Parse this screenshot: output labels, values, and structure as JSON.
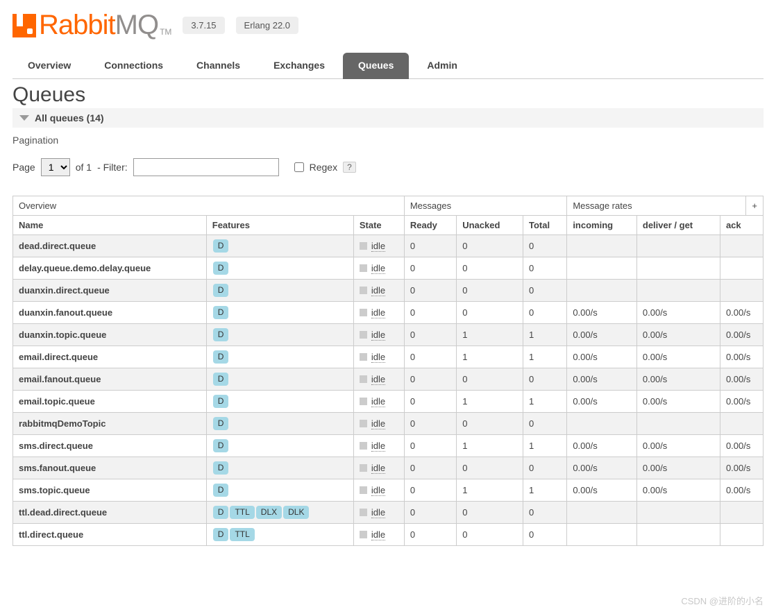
{
  "brand": {
    "text_left": "Rabbit",
    "text_right": "MQ",
    "tm": "TM"
  },
  "version_badges": [
    "3.7.15",
    "Erlang 22.0"
  ],
  "tabs": {
    "items": [
      "Overview",
      "Connections",
      "Channels",
      "Exchanges",
      "Queues",
      "Admin"
    ],
    "active_index": 4
  },
  "page_title": "Queues",
  "section_label": "All queues (14)",
  "pagination": {
    "title": "Pagination",
    "page_label": "Page",
    "page_value": "1",
    "of_text": "of 1",
    "filter_label": "- Filter:",
    "filter_value": "",
    "regex_label": "Regex",
    "help": "?"
  },
  "table": {
    "group_headers": [
      "Overview",
      "Messages",
      "Message rates",
      "+"
    ],
    "columns": [
      "Name",
      "Features",
      "State",
      "Ready",
      "Unacked",
      "Total",
      "incoming",
      "deliver / get",
      "ack"
    ],
    "rows": [
      {
        "name": "dead.direct.queue",
        "features": [
          "D"
        ],
        "state": "idle",
        "ready": "0",
        "unacked": "0",
        "total": "0",
        "incoming": "",
        "deliver": "",
        "ack": ""
      },
      {
        "name": "delay.queue.demo.delay.queue",
        "features": [
          "D"
        ],
        "state": "idle",
        "ready": "0",
        "unacked": "0",
        "total": "0",
        "incoming": "",
        "deliver": "",
        "ack": ""
      },
      {
        "name": "duanxin.direct.queue",
        "features": [
          "D"
        ],
        "state": "idle",
        "ready": "0",
        "unacked": "0",
        "total": "0",
        "incoming": "",
        "deliver": "",
        "ack": ""
      },
      {
        "name": "duanxin.fanout.queue",
        "features": [
          "D"
        ],
        "state": "idle",
        "ready": "0",
        "unacked": "0",
        "total": "0",
        "incoming": "0.00/s",
        "deliver": "0.00/s",
        "ack": "0.00/s"
      },
      {
        "name": "duanxin.topic.queue",
        "features": [
          "D"
        ],
        "state": "idle",
        "ready": "0",
        "unacked": "1",
        "total": "1",
        "incoming": "0.00/s",
        "deliver": "0.00/s",
        "ack": "0.00/s"
      },
      {
        "name": "email.direct.queue",
        "features": [
          "D"
        ],
        "state": "idle",
        "ready": "0",
        "unacked": "1",
        "total": "1",
        "incoming": "0.00/s",
        "deliver": "0.00/s",
        "ack": "0.00/s"
      },
      {
        "name": "email.fanout.queue",
        "features": [
          "D"
        ],
        "state": "idle",
        "ready": "0",
        "unacked": "0",
        "total": "0",
        "incoming": "0.00/s",
        "deliver": "0.00/s",
        "ack": "0.00/s"
      },
      {
        "name": "email.topic.queue",
        "features": [
          "D"
        ],
        "state": "idle",
        "ready": "0",
        "unacked": "1",
        "total": "1",
        "incoming": "0.00/s",
        "deliver": "0.00/s",
        "ack": "0.00/s"
      },
      {
        "name": "rabbitmqDemoTopic",
        "features": [
          "D"
        ],
        "state": "idle",
        "ready": "0",
        "unacked": "0",
        "total": "0",
        "incoming": "",
        "deliver": "",
        "ack": ""
      },
      {
        "name": "sms.direct.queue",
        "features": [
          "D"
        ],
        "state": "idle",
        "ready": "0",
        "unacked": "1",
        "total": "1",
        "incoming": "0.00/s",
        "deliver": "0.00/s",
        "ack": "0.00/s"
      },
      {
        "name": "sms.fanout.queue",
        "features": [
          "D"
        ],
        "state": "idle",
        "ready": "0",
        "unacked": "0",
        "total": "0",
        "incoming": "0.00/s",
        "deliver": "0.00/s",
        "ack": "0.00/s"
      },
      {
        "name": "sms.topic.queue",
        "features": [
          "D"
        ],
        "state": "idle",
        "ready": "0",
        "unacked": "1",
        "total": "1",
        "incoming": "0.00/s",
        "deliver": "0.00/s",
        "ack": "0.00/s"
      },
      {
        "name": "ttl.dead.direct.queue",
        "features": [
          "D",
          "TTL",
          "DLX",
          "DLK"
        ],
        "state": "idle",
        "ready": "0",
        "unacked": "0",
        "total": "0",
        "incoming": "",
        "deliver": "",
        "ack": ""
      },
      {
        "name": "ttl.direct.queue",
        "features": [
          "D",
          "TTL"
        ],
        "state": "idle",
        "ready": "0",
        "unacked": "0",
        "total": "0",
        "incoming": "",
        "deliver": "",
        "ack": ""
      }
    ]
  },
  "watermark": "CSDN @进阶的小名"
}
